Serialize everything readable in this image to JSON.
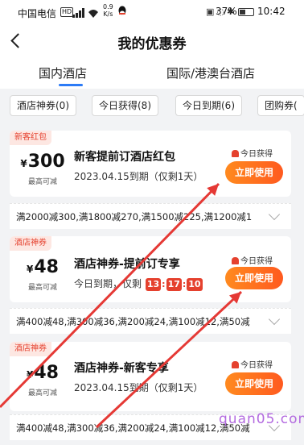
{
  "status_bar": {
    "carrier": "中国电信",
    "hd": "HD",
    "net_speed_value": "0.9",
    "net_speed_unit": "K/s",
    "battery": "37%",
    "time": "10:42",
    "icons": [
      "signal-icon",
      "wifi-icon",
      "qq-icon",
      "nfc-icon",
      "mute-icon",
      "bluetooth-icon",
      "battery-icon"
    ]
  },
  "header": {
    "title": "我的优惠券"
  },
  "tabs": [
    {
      "label": "国内酒店",
      "active": true
    },
    {
      "label": "国际/港澳台酒店",
      "active": false
    }
  ],
  "filters": [
    {
      "label": "酒店神券(0)"
    },
    {
      "label": "今日获得(8)"
    },
    {
      "label": "今日到期(6)"
    },
    {
      "label": "团购券("
    }
  ],
  "coupons": [
    {
      "tag": "新客红包",
      "currency": "¥",
      "amount": "300",
      "amount_sub": "最高可减",
      "name": "新客提前订酒店红包",
      "expiry": "2023.04.15到期（仅剩1天）",
      "obtained": "今日获得",
      "use_label": "立即使用",
      "rules": "满2000减300,满1800减270,满1500减225,满1200减1"
    },
    {
      "tag": "酒店神券",
      "currency": "¥",
      "amount": "48",
      "amount_sub": "最高可减",
      "name": "酒店神券-提前订专享",
      "expiry_prefix": "今日到期，仅剩",
      "countdown": [
        "13",
        "17",
        "10"
      ],
      "obtained": "今日获得",
      "use_label": "立即使用",
      "rules": "满400减48,满300减36,满200减24,满100减12,满50减"
    },
    {
      "tag": "酒店神券",
      "currency": "¥",
      "amount": "48",
      "amount_sub": "最高可减",
      "name": "酒店神券-新客专享",
      "expiry": "2023.04.15到期（仅剩1天）",
      "obtained": "今日获得",
      "use_label": "立即使用",
      "rules": "满400减48,满300减36,满200减24,满100减12,满50减"
    }
  ],
  "annotation": {
    "arrow_color": "#e53935"
  },
  "watermark": "quan05.com"
}
